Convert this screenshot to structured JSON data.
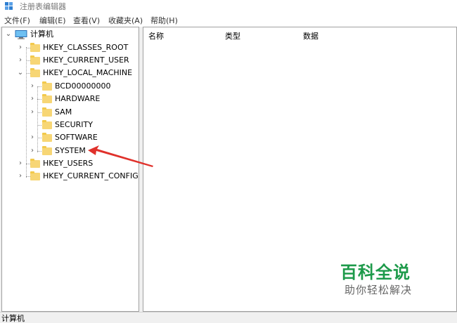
{
  "window": {
    "title": "注册表编辑器",
    "icon": "regedit-icon"
  },
  "menu": [
    {
      "label": "文件(F)"
    },
    {
      "label": "编辑(E)"
    },
    {
      "label": "查看(V)"
    },
    {
      "label": "收藏夹(A)"
    },
    {
      "label": "帮助(H)"
    }
  ],
  "tree": {
    "root": {
      "label": "计算机",
      "expanded": true
    },
    "hives": [
      {
        "label": "HKEY_CLASSES_ROOT",
        "expandable": true
      },
      {
        "label": "HKEY_CURRENT_USER",
        "expandable": true
      },
      {
        "label": "HKEY_LOCAL_MACHINE",
        "expanded": true
      },
      {
        "label": "HKEY_USERS",
        "expandable": true
      },
      {
        "label": "HKEY_CURRENT_CONFIG",
        "expandable": true
      }
    ],
    "hklm_children": [
      {
        "label": "BCD00000000",
        "expandable": true
      },
      {
        "label": "HARDWARE",
        "expandable": true
      },
      {
        "label": "SAM",
        "expandable": true
      },
      {
        "label": "SECURITY",
        "expandable": false
      },
      {
        "label": "SOFTWARE",
        "expandable": true
      },
      {
        "label": "SYSTEM",
        "expandable": true
      }
    ]
  },
  "list": {
    "columns": [
      "名称",
      "类型",
      "数据"
    ]
  },
  "status": {
    "path": "计算机"
  },
  "annotation": {
    "arrow_color": "#e0312b",
    "target": "SYSTEM"
  },
  "watermark": {
    "title": "百科全说",
    "subtitle": "助你轻松解决",
    "color": "#1d9a4a"
  }
}
